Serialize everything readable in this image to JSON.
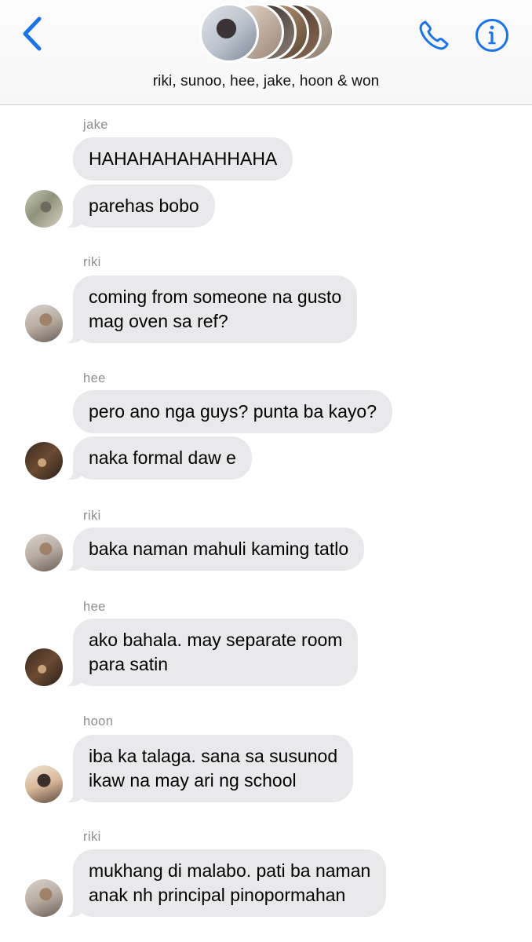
{
  "header": {
    "group_title": "riki, sunoo, hee, jake, hoon & won",
    "accent_color": "#1a73e8",
    "icons": [
      "chevron-left-icon",
      "phone-icon",
      "info-icon"
    ]
  },
  "messages": [
    {
      "sender": "jake",
      "texts": [
        "HAHAHAHAHAHHAHA",
        "parehas bobo"
      ]
    },
    {
      "sender": "riki",
      "texts": [
        [
          "coming from someone na gusto",
          "mag oven sa ref?"
        ]
      ]
    },
    {
      "sender": "hee",
      "texts": [
        "pero ano nga guys? punta ba kayo?",
        "naka formal daw e"
      ]
    },
    {
      "sender": "riki",
      "texts": [
        "baka naman mahuli kaming tatlo"
      ]
    },
    {
      "sender": "hee",
      "texts": [
        [
          "ako bahala. may separate room",
          "para satin"
        ]
      ]
    },
    {
      "sender": "hoon",
      "texts": [
        [
          "iba ka talaga. sana sa susunod",
          "ikaw na may ari ng school"
        ]
      ]
    },
    {
      "sender": "riki",
      "texts": [
        [
          "mukhang di malabo. pati ba naman",
          "anak nh principal pinopormahan"
        ]
      ]
    }
  ],
  "colors": {
    "bubble_incoming": "#e9e9eb",
    "sender_label": "#8e8e93",
    "accent": "#1a73e8"
  }
}
